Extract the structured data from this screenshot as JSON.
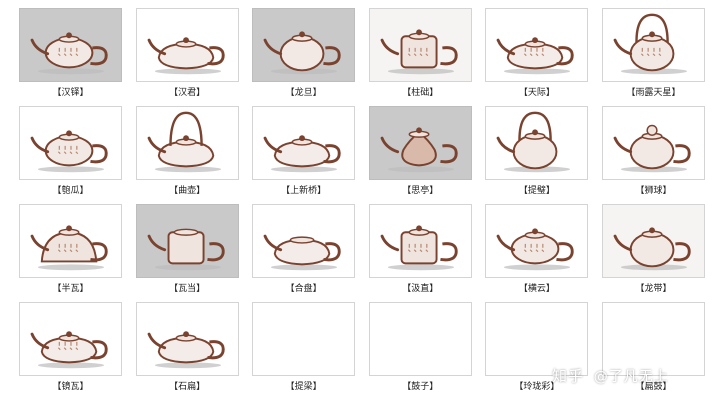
{
  "teapots": [
    {
      "label": "【汉铎】",
      "bg": "gray",
      "body": "ellipse",
      "handle": "loop",
      "lid": "knob",
      "text": true
    },
    {
      "label": "【汉君】",
      "bg": "white",
      "body": "flat",
      "handle": "loop",
      "lid": "knob",
      "text": false
    },
    {
      "label": "【龙旦】",
      "bg": "gray",
      "body": "round",
      "handle": "loop",
      "lid": "knob",
      "text": false
    },
    {
      "label": "【柱础】",
      "bg": "paper",
      "body": "column",
      "handle": "loop",
      "lid": "knob",
      "text": true
    },
    {
      "label": "【天际】",
      "bg": "white",
      "body": "flat",
      "handle": "loop",
      "lid": "knob",
      "text": true
    },
    {
      "label": "【雨露天星】",
      "bg": "white",
      "body": "round",
      "handle": "top",
      "lid": "knob",
      "text": true
    },
    {
      "label": "【匏瓜】",
      "bg": "white",
      "body": "ellipse",
      "handle": "loop",
      "lid": "knob",
      "text": true
    },
    {
      "label": "【曲壶】",
      "bg": "white",
      "body": "flat",
      "handle": "top",
      "lid": "knob",
      "text": false
    },
    {
      "label": "【上新桥】",
      "bg": "white",
      "body": "flat",
      "handle": "loop",
      "lid": "knob",
      "text": false
    },
    {
      "label": "【思亭】",
      "bg": "gray",
      "body": "pear",
      "handle": "loop",
      "lid": "knob",
      "text": false
    },
    {
      "label": "【提璧】",
      "bg": "white",
      "body": "round",
      "handle": "top",
      "lid": "knob",
      "text": false
    },
    {
      "label": "【狮球】",
      "bg": "white",
      "body": "round",
      "handle": "loop",
      "lid": "lion",
      "text": false
    },
    {
      "label": "【半瓦】",
      "bg": "white",
      "body": "half",
      "handle": "loop",
      "lid": "knob",
      "text": true
    },
    {
      "label": "【瓦当】",
      "bg": "gray",
      "body": "column",
      "handle": "loop",
      "lid": "flat",
      "text": false
    },
    {
      "label": "【合盘】",
      "bg": "white",
      "body": "flat",
      "handle": "loop",
      "lid": "flat",
      "text": false
    },
    {
      "label": "【汲直】",
      "bg": "white",
      "body": "column",
      "handle": "loop",
      "lid": "knob",
      "text": true
    },
    {
      "label": "【横云】",
      "bg": "white",
      "body": "ellipse",
      "handle": "loop",
      "lid": "knob",
      "text": true
    },
    {
      "label": "【龙带】",
      "bg": "paper",
      "body": "round",
      "handle": "loop",
      "lid": "knob",
      "text": false
    },
    {
      "label": "【镜瓦】",
      "bg": "white",
      "body": "flat",
      "handle": "loop",
      "lid": "knob",
      "text": true
    },
    {
      "label": "【石扁】",
      "bg": "white",
      "body": "flat",
      "handle": "loop",
      "lid": "knob",
      "text": false
    },
    {
      "label": "【提梁】",
      "bg": "white",
      "body": "none",
      "handle": "none",
      "lid": "none",
      "text": false
    },
    {
      "label": "【鼓子】",
      "bg": "white",
      "body": "none",
      "handle": "none",
      "lid": "none",
      "text": false
    },
    {
      "label": "【玲珑彩】",
      "bg": "white",
      "body": "none",
      "handle": "none",
      "lid": "none",
      "text": false
    },
    {
      "label": "【扁鼓】",
      "bg": "white",
      "body": "none",
      "handle": "none",
      "lid": "none",
      "text": false
    }
  ],
  "watermark": {
    "platform": "知乎",
    "author": "@了凡无上"
  },
  "colors": {
    "clay": "#7a4330",
    "clay_light": "#b8866f",
    "shadow": "#9a9a9a",
    "text": "#222222"
  }
}
